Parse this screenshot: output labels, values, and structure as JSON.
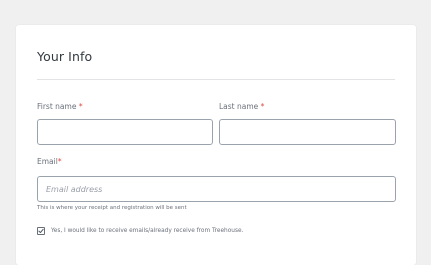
{
  "form": {
    "title": "Your Info",
    "first_name": {
      "label": "First name",
      "required_mark": "*",
      "value": "",
      "placeholder": ""
    },
    "last_name": {
      "label": "Last name",
      "required_mark": "*",
      "value": "",
      "placeholder": ""
    },
    "email": {
      "label": "Email",
      "required_mark": "*",
      "value": "",
      "placeholder": "Email address",
      "help_text": "This is where your receipt and registration will be sent"
    },
    "consent": {
      "checked": true,
      "label": "Yes, I would like to receive emails/already receive from Treehouse."
    }
  },
  "colors": {
    "required": "#e0473f",
    "field_border": "#9aa3ac",
    "background": "#f0f0f1"
  }
}
